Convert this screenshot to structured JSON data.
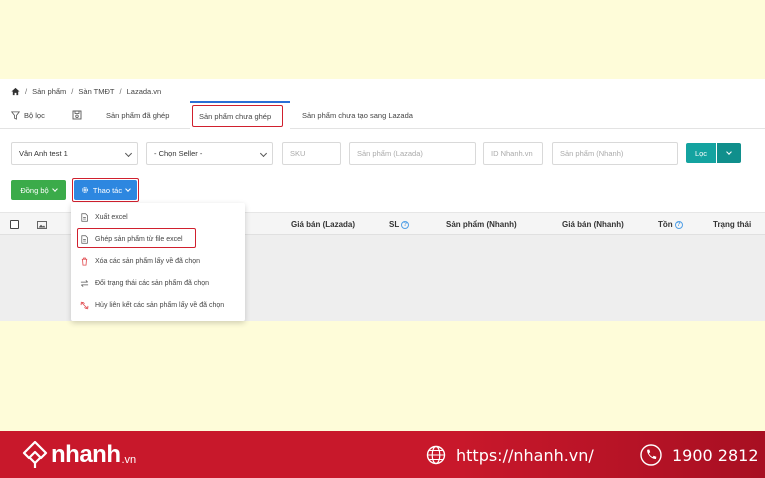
{
  "breadcrumb": [
    "Sản phẩm",
    "Sàn TMĐT",
    "Lazada.vn"
  ],
  "tabs": {
    "filter": "Bộ lọc",
    "matched": "Sản phẩm đã ghép",
    "unmatched": "Sản phẩm chưa ghép",
    "not_created": "Sản phẩm chưa tạo sang Lazada"
  },
  "filters": {
    "shop": "Vân Anh test 1",
    "seller": "- Chọn Seller -",
    "sku": "SKU",
    "product_lazada": "Sản phẩm (Lazada)",
    "id_nhanh": "ID Nhanh.vn",
    "product_nhanh": "Sản phẩm (Nhanh)",
    "filter_button": "Lọc"
  },
  "actions": {
    "sync": "Đồng bộ",
    "operations": "Thao tác"
  },
  "menu": [
    {
      "label": "Xuất excel",
      "icon": "file-icon"
    },
    {
      "label": "Ghép sản phẩm từ file excel",
      "icon": "file-icon"
    },
    {
      "label": "Xóa các sản phẩm lấy về đã chọn",
      "icon": "trash-icon"
    },
    {
      "label": "Đổi trạng thái các sản phẩm đã chọn",
      "icon": "swap-icon"
    },
    {
      "label": "Hủy liên kết các sản phẩm lấy về đã chọn",
      "icon": "unlink-icon"
    }
  ],
  "table": {
    "columns": [
      "Giá bán (Lazada)",
      "SL",
      "Sản phẩm (Nhanh)",
      "Giá bán (Nhanh)",
      "Tồn",
      "Trạng thái"
    ],
    "help_mark": "?"
  },
  "footer": {
    "brand": "nhanh",
    "brand_suffix": ".vn",
    "url": "https://nhanh.vn/",
    "phone": "1900 2812"
  },
  "colors": {
    "accent_blue": "#2d87e0",
    "teal": "#14a3a0",
    "green": "#3bab4a",
    "highlight_red": "#d0202e",
    "footer_red": "#c8182b",
    "background": "#fefcd9"
  }
}
